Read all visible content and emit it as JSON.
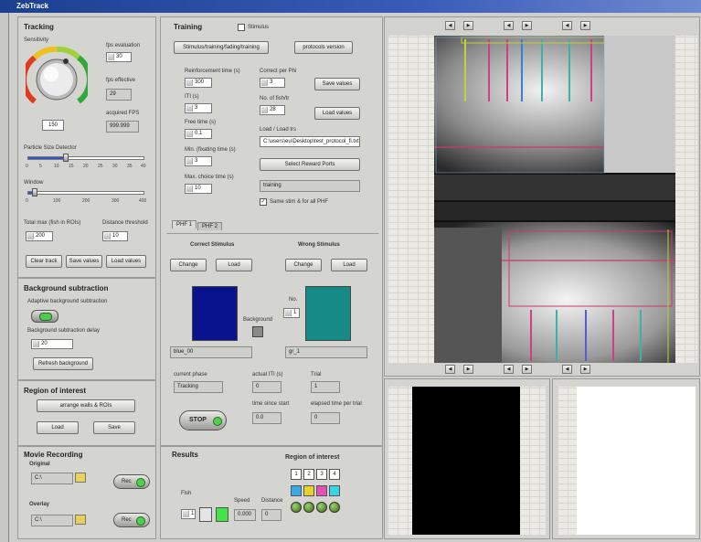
{
  "window": {
    "title": "ZebTrack"
  },
  "tracking": {
    "title": "Tracking",
    "sensitivity_label": "Sensitivity",
    "sensitivity_value": "150",
    "sensitivity_level": 0.55,
    "fps_label": "fps evaluation",
    "fps_value": "30",
    "fps_effective_label": "fps effective",
    "fps_effective_value": "29",
    "acquired_label": "acquired FPS",
    "acquired_value": "999.999",
    "particle_label": "Particle Size Detector",
    "particle_ticks": [
      "0",
      "5",
      "10",
      "15",
      "20",
      "25",
      "30",
      "35",
      "40"
    ],
    "particle_level": 0.32,
    "window_label": "Window",
    "window_ticks": [
      "0",
      "100",
      "200",
      "300",
      "400"
    ],
    "window_level": 0.05,
    "max_fish_label": "Total max (fish in ROIs)",
    "max_fish_value": "200",
    "distance_label": "Distance threshold",
    "distance_value": "10",
    "btn_clear": "Clear track",
    "btn_save": "Save values",
    "btn_load": "Load values"
  },
  "background": {
    "title": "Background subtraction",
    "adaptive_label": "Adaptive background subtraction",
    "delay_label": "Background subtraction delay",
    "delay_value": "20",
    "refresh_btn": "Refresh background"
  },
  "roi": {
    "title": "Region of interest",
    "arrange_btn": "arrange walls & ROIs",
    "load_btn": "Load",
    "save_btn": "Save"
  },
  "movie": {
    "title": "Movie Recording",
    "original_label": "Original",
    "original_path": "C:\\",
    "overlay_label": "Overlay",
    "overlay_path": "C:\\",
    "rec_label": "Rec"
  },
  "training": {
    "title": "Training",
    "stimulus_label": "Stimulus",
    "mode_select": "Stimulus/training/fading/training",
    "protocol_select": "protocols version",
    "reinforce_label": "Reinforcement time (s)",
    "reinforce_value": "300",
    "iti_label": "ITI (s)",
    "iti_value": "3",
    "free_label": "Free time (s)",
    "free_value": "0.1",
    "min_label": "Min. (fixating time (s)",
    "min_value": "3",
    "max_label": "Max. choice time (s)",
    "max_value": "10",
    "correct_pp_label": "Correct per Phi",
    "correct_pp_value": "3",
    "nfish_label": "No. of fish/tr",
    "nfish_value": "28",
    "save_values_btn": "Save values",
    "load_values_btn": "Load values",
    "load_path_label": "Load / Load trs",
    "load_path_value": "C:\\users\\eu\\Desktop\\test_protocol_fi.txt",
    "ports_btn": "Select Reward Ports",
    "status_value": "training",
    "same_stim_label": "Same stim & for all PHF",
    "tabs": [
      "PHF 1",
      "PHF 2"
    ],
    "correct_title": "Correct Stimulus",
    "wrong_title": "Wrong Stimulus",
    "change_label": "Change",
    "load_label": "Load",
    "background_label": "Background",
    "no_label": "No.",
    "no_value": "1",
    "correct_color": "#0a138e",
    "wrong_color": "#168a86",
    "correct_name": "blue_00",
    "wrong_name": "gr_1",
    "current_state_label": "current phase",
    "current_state_value": "Tracking",
    "actual_iti_label": "actual ITI (s)",
    "actual_iti_value": "0",
    "trial_label": "Trial",
    "trial_value": "1",
    "time_since_label": "time since start",
    "time_since_value": "0.0",
    "elapsed_label": "elapsed time per trial",
    "elapsed_value": "0",
    "stop_btn": "STOP"
  },
  "results": {
    "title": "Results",
    "roi_title": "Region of interest",
    "fish_label": "Fish",
    "fish_value": "1",
    "speed_label": "Speed",
    "speed_value": "0.000",
    "distance_label": "Distance",
    "distance_value": "0",
    "roi_numbers": [
      "1",
      "2",
      "3",
      "4"
    ],
    "roi_colors": [
      "#3aa7e6",
      "#e8d12a",
      "#e54fb6",
      "#35d6e0"
    ]
  },
  "nav": {
    "top": [
      "◀",
      "▶",
      "◀",
      "▶",
      "◀",
      "▶"
    ],
    "bottom": [
      "◀",
      "▶",
      "◀",
      "▶",
      "◀",
      "▶"
    ]
  }
}
